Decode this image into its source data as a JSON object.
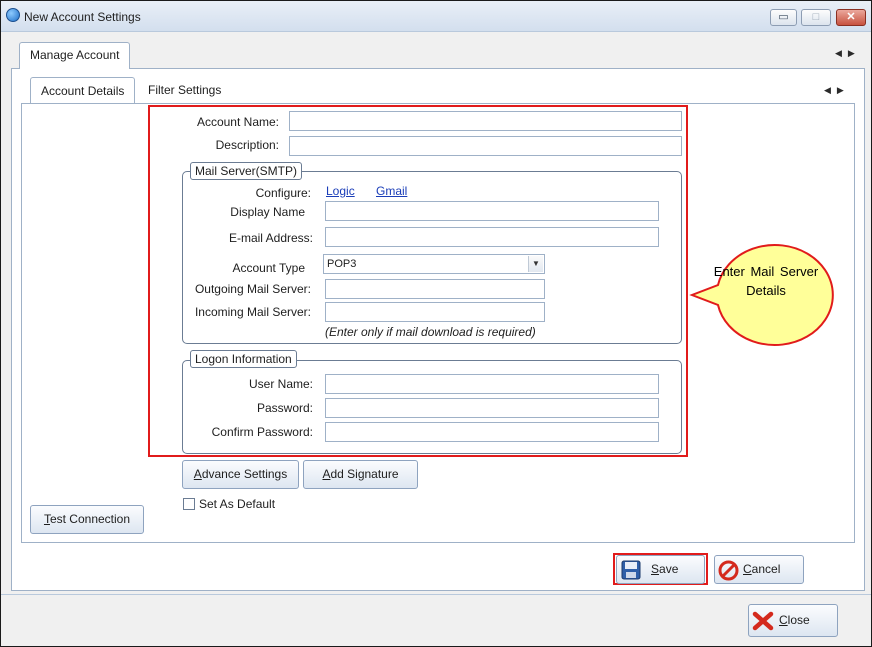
{
  "window": {
    "title": "New Account Settings",
    "controls": {
      "minimize": "▭",
      "maximize": "□",
      "close": "✕"
    }
  },
  "outer_tabs": [
    {
      "label": "Manage Account",
      "active": true
    }
  ],
  "inner_tabs": [
    {
      "label": "Account Details",
      "active": true
    },
    {
      "label": "Filter Settings",
      "active": false
    }
  ],
  "scroll_arrows": {
    "left": "◀",
    "right": "▶"
  },
  "form": {
    "account_name_label": "Account Name:",
    "account_name_value": "",
    "description_label": "Description:",
    "description_value": ""
  },
  "mail_server": {
    "title": "Mail Server(SMTP)",
    "configure_label": "Configure:",
    "configure_links": [
      "Logic",
      "Gmail"
    ],
    "display_name_label": "Display Name",
    "email_label": "E-mail Address:",
    "account_type_label": "Account Type",
    "account_type_value": "POP3",
    "outgoing_label": "Outgoing Mail Server:",
    "incoming_label": "Incoming Mail Server:",
    "hint": "(Enter only if mail download is required)"
  },
  "logon": {
    "title": "Logon Information",
    "user_name_label": "User Name:",
    "password_label": "Password:",
    "confirm_label": "Confirm Password:"
  },
  "buttons": {
    "advance_settings": {
      "u": "A",
      "rest": "dvance Settings"
    },
    "add_signature": {
      "u": "A",
      "rest": "dd Signature"
    },
    "set_default": "Set As Default",
    "test_connection": {
      "u": "T",
      "rest": "est Connection"
    },
    "save": {
      "u": "S",
      "rest": "ave"
    },
    "cancel": {
      "u": "C",
      "rest": "ancel"
    },
    "close": {
      "u": "C",
      "rest": "lose"
    }
  },
  "callout": {
    "text": "Enter  Mail Server Details"
  },
  "colors": {
    "highlight": "#e11b1b",
    "callout_fill": "#ffff99",
    "link": "#1a3db8"
  },
  "icons": [
    "app-icon",
    "save-disk-icon",
    "cancel-icon",
    "close-x-icon",
    "chevron-down-icon"
  ]
}
